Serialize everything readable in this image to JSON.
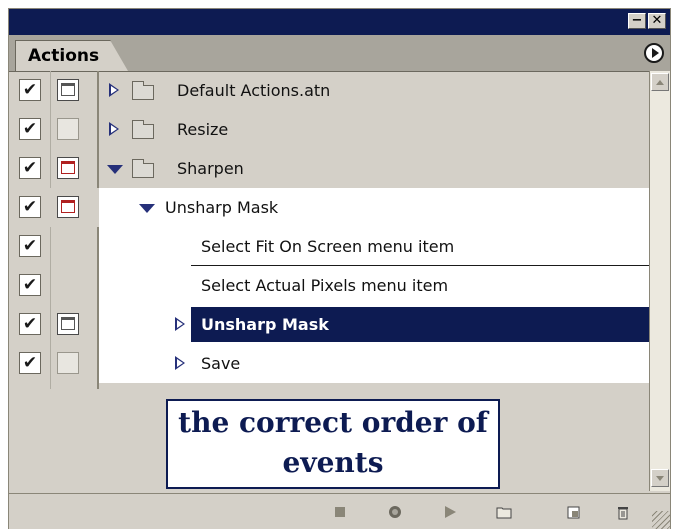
{
  "panel": {
    "tab_label": "Actions",
    "titlebar": {
      "minimize_glyph": "−",
      "close_glyph": "✕"
    }
  },
  "rows": [
    {
      "label": "Default Actions.atn",
      "type": "set",
      "expanded": false,
      "checked": true,
      "dialog": "on"
    },
    {
      "label": "Resize",
      "type": "set",
      "expanded": false,
      "checked": true,
      "dialog": "off"
    },
    {
      "label": "Sharpen",
      "type": "set",
      "expanded": true,
      "checked": true,
      "dialog": "red"
    },
    {
      "label": "Unsharp Mask",
      "type": "action",
      "expanded": true,
      "checked": true,
      "dialog": "red"
    },
    {
      "label": "Select Fit On Screen menu item",
      "type": "command",
      "checked": true,
      "dialog": "none"
    },
    {
      "label": "Select Actual Pixels menu item",
      "type": "command",
      "checked": true,
      "dialog": "none"
    },
    {
      "label": "Unsharp Mask",
      "type": "command",
      "selected": true,
      "checked": true,
      "dialog": "on"
    },
    {
      "label": "Save",
      "type": "command",
      "checked": true,
      "dialog": "off"
    }
  ],
  "check_glyph": "✔",
  "annotation": {
    "line1": "the correct order of",
    "line2": "events"
  },
  "bottom_toolbar": [
    "stop-icon",
    "record-icon",
    "play-icon",
    "new-set-icon",
    "new-action-icon",
    "delete-icon"
  ],
  "colors": {
    "titlebar": "#0d1b52",
    "selected_row": "#0d1b52",
    "panel": "#d4d0c8",
    "disclosure": "#26307a"
  }
}
